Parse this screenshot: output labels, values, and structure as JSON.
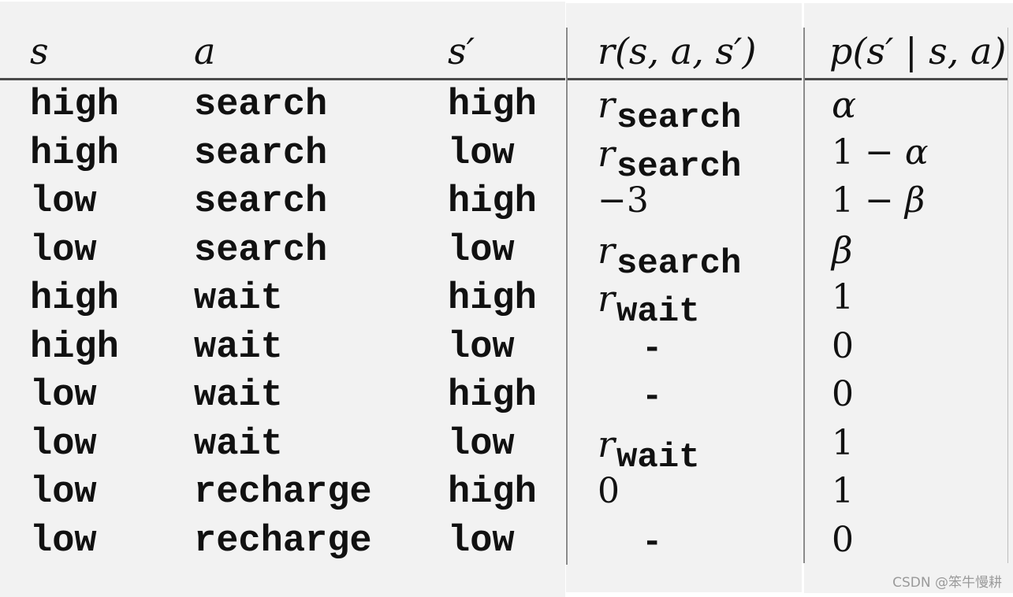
{
  "table": {
    "headers": [
      "s",
      "a",
      "s′",
      "r(s, a, s′)",
      "p(s′ | s, a)"
    ],
    "rows": [
      {
        "s": "high",
        "a": "search",
        "s_next": "high",
        "r": {
          "base": "r",
          "sub": "search"
        },
        "p": "α"
      },
      {
        "s": "high",
        "a": "search",
        "s_next": "low",
        "r": {
          "base": "r",
          "sub": "search"
        },
        "p": "1 − α"
      },
      {
        "s": "low",
        "a": "search",
        "s_next": "high",
        "r": {
          "text": "−3"
        },
        "p": "1 − β"
      },
      {
        "s": "low",
        "a": "search",
        "s_next": "low",
        "r": {
          "base": "r",
          "sub": "search"
        },
        "p": "β"
      },
      {
        "s": "high",
        "a": "wait",
        "s_next": "high",
        "r": {
          "base": "r",
          "sub": "wait"
        },
        "p": "1"
      },
      {
        "s": "high",
        "a": "wait",
        "s_next": "low",
        "r": {
          "dash": "-"
        },
        "p": "0"
      },
      {
        "s": "low",
        "a": "wait",
        "s_next": "high",
        "r": {
          "dash": "-"
        },
        "p": "0"
      },
      {
        "s": "low",
        "a": "wait",
        "s_next": "low",
        "r": {
          "base": "r",
          "sub": "wait"
        },
        "p": "1"
      },
      {
        "s": "low",
        "a": "recharge",
        "s_next": "high",
        "r": {
          "text": "0"
        },
        "p": "1"
      },
      {
        "s": "low",
        "a": "recharge",
        "s_next": "low",
        "r": {
          "dash": "-"
        },
        "p": "0"
      }
    ]
  },
  "watermark": "CSDN @笨牛慢耕",
  "colors": {
    "background": "#f2f2f2",
    "text": "#111111",
    "rule": "#4a4a4a"
  }
}
